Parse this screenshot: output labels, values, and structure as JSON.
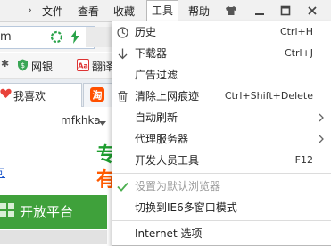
{
  "menubar": {
    "items": [
      "文件",
      "查看",
      "收藏",
      "工具",
      "帮助"
    ]
  },
  "address_bar": {
    "partial_text": "m"
  },
  "favorites": {
    "items": [
      "网银",
      "翻译"
    ]
  },
  "tabs": [
    {
      "label": "我喜欢"
    }
  ],
  "content": {
    "username": "mfkhka",
    "slogan_line1": "专",
    "slogan_line2": "有",
    "link_partial": "问",
    "open_platform_label": "开放平台"
  },
  "tools_menu": {
    "items": [
      {
        "label": "历史",
        "shortcut": "Ctrl+H",
        "icon": "clock-icon"
      },
      {
        "label": "下载器",
        "shortcut": "Ctrl+J",
        "icon": "download-arrow-icon"
      },
      {
        "label": "广告过滤",
        "shortcut": "",
        "icon": ""
      },
      {
        "label": "清除上网痕迹",
        "shortcut": "Ctrl+Shift+Delete",
        "icon": "trash-icon"
      },
      {
        "label": "自动刷新",
        "shortcut": "",
        "icon": "",
        "submenu": true
      },
      {
        "label": "代理服务器",
        "shortcut": "",
        "icon": "",
        "submenu": true
      },
      {
        "label": "开发人员工具",
        "shortcut": "F12",
        "icon": ""
      },
      {
        "label": "设置为默认浏览器",
        "shortcut": "",
        "icon": "checkmark-icon",
        "disabled": true
      },
      {
        "label": "切换到IE6多窗口模式",
        "shortcut": "",
        "icon": ""
      },
      {
        "label": "Internet 选项",
        "shortcut": "",
        "icon": ""
      }
    ]
  },
  "colors": {
    "accent_green": "#3fa13b",
    "slogan_green": "#1e9e2f",
    "slogan_orange": "#ff5a00",
    "check_green": "#4caf50"
  }
}
